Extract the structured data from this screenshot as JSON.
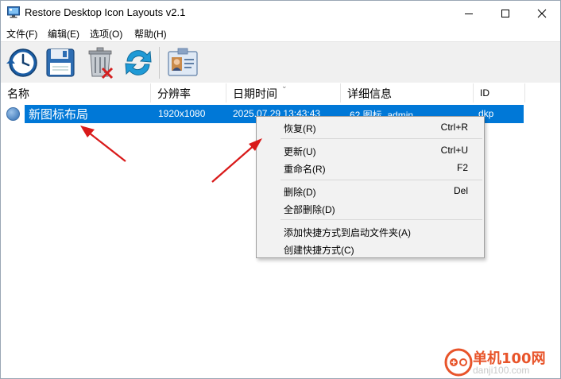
{
  "window": {
    "title": "Restore Desktop Icon Layouts v2.1",
    "controls": [
      "minimize",
      "maximize",
      "close"
    ]
  },
  "menu": [
    {
      "label": "文件(F)"
    },
    {
      "label": "编辑(E)"
    },
    {
      "label": "选项(O)"
    },
    {
      "label": "帮助(H)"
    }
  ],
  "toolbar": {
    "icons": [
      "restore-clock-icon",
      "save-disk-icon",
      "delete-trash-icon",
      "refresh-icon",
      "contact-card-icon"
    ]
  },
  "list": {
    "columns": [
      {
        "label": "名称"
      },
      {
        "label": "分辨率"
      },
      {
        "label": "日期时间"
      },
      {
        "label": "详细信息"
      },
      {
        "label": "ID"
      }
    ],
    "rows": [
      {
        "name": "新图标布局",
        "resolution": "1920x1080",
        "datetime": "2025.07.29 13:43:43",
        "details": "62 图标, admin",
        "id": "dkp"
      }
    ]
  },
  "context_menu": {
    "items": [
      {
        "label": "恢复(R)",
        "shortcut": "Ctrl+R"
      },
      {
        "label": "更新(U)",
        "shortcut": "Ctrl+U"
      },
      {
        "label": "重命名(R)",
        "shortcut": "F2"
      },
      {
        "label": "删除(D)",
        "shortcut": "Del"
      },
      {
        "label": "全部删除(D)",
        "shortcut": ""
      },
      {
        "label": "添加快捷方式到启动文件夹(A)",
        "shortcut": ""
      },
      {
        "label": "创建快捷方式(C)",
        "shortcut": ""
      }
    ]
  },
  "watermark": {
    "name": "单机100网",
    "url": "danji100.com"
  },
  "colors": {
    "selection": "#0078d7",
    "toolbar_bg": "#f0f0f0",
    "menu_bg": "#f2f2f2",
    "arrow": "#e02020",
    "watermark": "#e8542a"
  }
}
